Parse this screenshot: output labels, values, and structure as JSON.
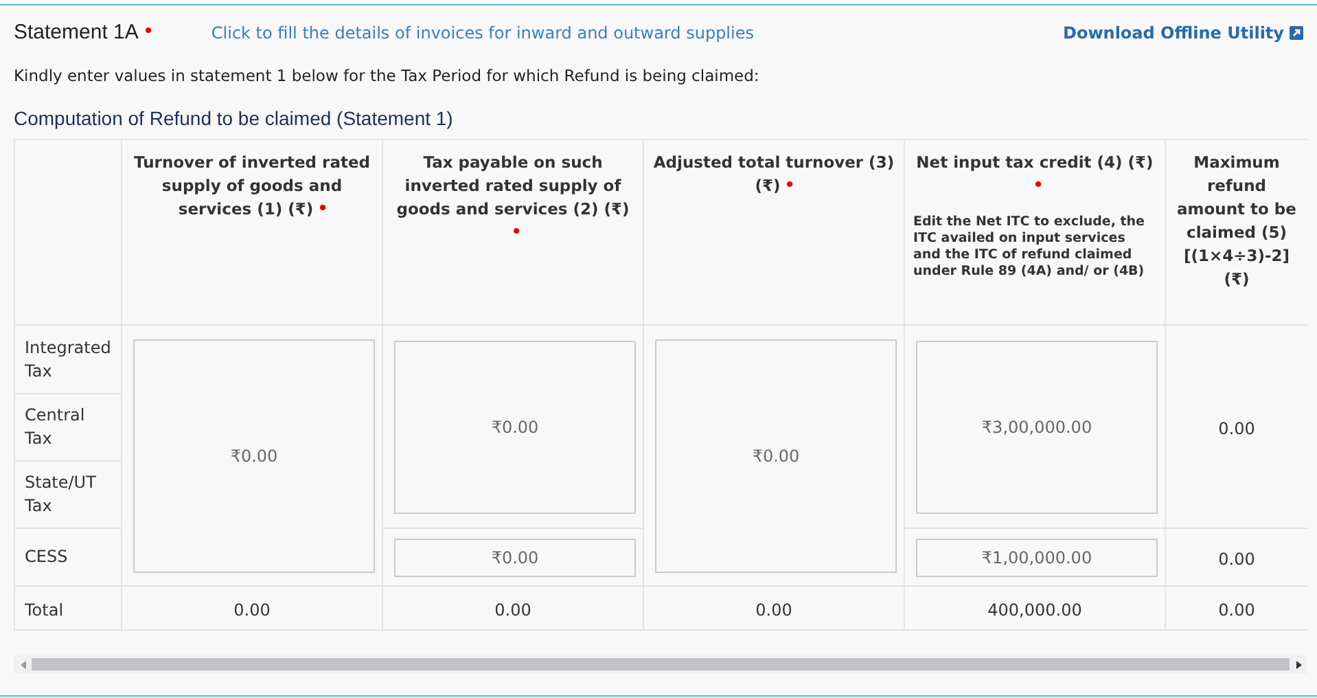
{
  "header": {
    "title": "Statement 1A",
    "required": true,
    "fill_link": "Click to fill the details of invoices for inward and outward supplies",
    "download_link": "Download Offline Utility"
  },
  "instruction": "Kindly enter values in statement 1 below for the Tax Period for which Refund is being claimed:",
  "section_title": "Computation of Refund to be claimed (Statement 1)",
  "table": {
    "row_labels": [
      "Integrated Tax",
      "Central Tax",
      "State/UT Tax",
      "CESS"
    ],
    "total_label": "Total",
    "columns": [
      {
        "kind": "merged",
        "label": "Turnover of inverted rated supply of goods and services (1) (₹)",
        "required": true,
        "values": [
          "₹0.00"
        ],
        "total": "0.00"
      },
      {
        "kind": "split",
        "label": "Tax payable on such inverted rated supply of goods and services (2) (₹)",
        "required": true,
        "values": [
          "₹0.00",
          "₹0.00"
        ],
        "total": "0.00"
      },
      {
        "kind": "merged",
        "label": "Adjusted total turnover (3) (₹)",
        "required": true,
        "values": [
          "₹0.00"
        ],
        "total": "0.00"
      },
      {
        "kind": "split",
        "label": "Net input tax credit (4) (₹)",
        "required": true,
        "note": "Edit the Net ITC to exclude, the ITC availed on input services and the ITC of refund claimed under Rule 89 (4A) and/ or (4B)",
        "values": [
          "₹3,00,000.00",
          "₹1,00,000.00"
        ],
        "total": "400,000.00"
      },
      {
        "kind": "computed",
        "label": "Maximum refund amount to be claimed (5) [(1×4÷3)-2] (₹)",
        "required": false,
        "values": [
          "0.00",
          "0.00"
        ],
        "total": "0.00"
      }
    ]
  }
}
